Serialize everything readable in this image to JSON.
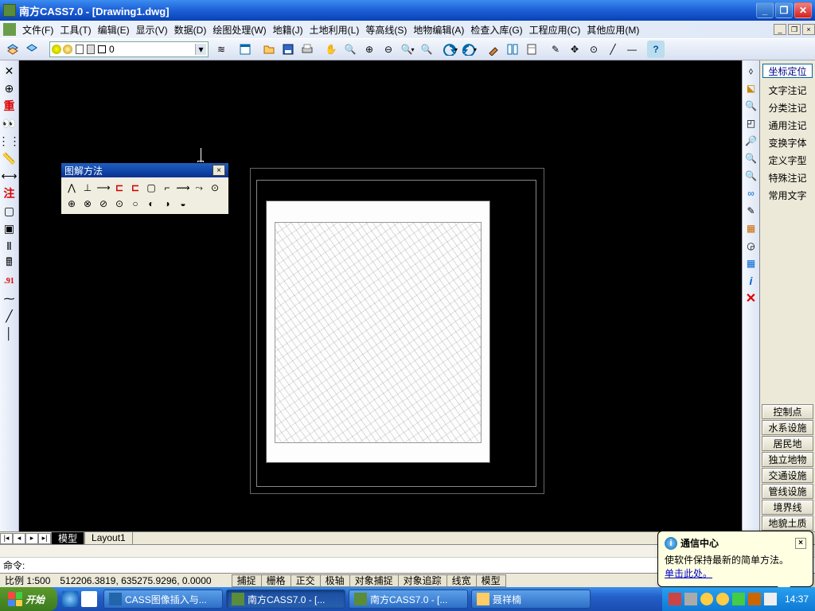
{
  "title": "南方CASS7.0 - [Drawing1.dwg]",
  "menu": [
    "文件(F)",
    "工具(T)",
    "编辑(E)",
    "显示(V)",
    "数据(D)",
    "绘图处理(W)",
    "地籍(J)",
    "土地利用(L)",
    "等高线(S)",
    "地物编辑(A)",
    "检查入库(G)",
    "工程应用(C)",
    "其他应用(M)"
  ],
  "layer_value": "0",
  "float_title": "图解方法",
  "tabs": {
    "model": "模型",
    "layout": "Layout1"
  },
  "cmd_prompt": "命令:",
  "status": {
    "scale": "比例 1:500",
    "coords": "512206.3819, 635275.9296, 0.0000",
    "buttons": [
      "捕捉",
      "栅格",
      "正交",
      "极轴",
      "对象捕捉",
      "对象追踪",
      "线宽",
      "模型"
    ]
  },
  "right_head": "坐标定位",
  "right_items": [
    "文字注记",
    "分类注记",
    "通用注记",
    "变换字体",
    "定义字型",
    "特殊注记",
    "常用文字"
  ],
  "right_btns": [
    "控制点",
    "水系设施",
    "居民地",
    "独立地物",
    "交通设施",
    "管线设施",
    "境界线",
    "地貌土质"
  ],
  "balloon": {
    "title": "通信中心",
    "line1": "使软件保持最新的简单方法。",
    "link": "单击此处。"
  },
  "taskbar": {
    "start": "开始",
    "tasks": [
      "CASS图像插入与...",
      "南方CASS7.0 - [...",
      "南方CASS7.0 - [...",
      "聂祥楠"
    ],
    "clock": "14:37"
  },
  "left_text": {
    "chong": "重",
    "zhu": "注",
    "num": ".91"
  }
}
